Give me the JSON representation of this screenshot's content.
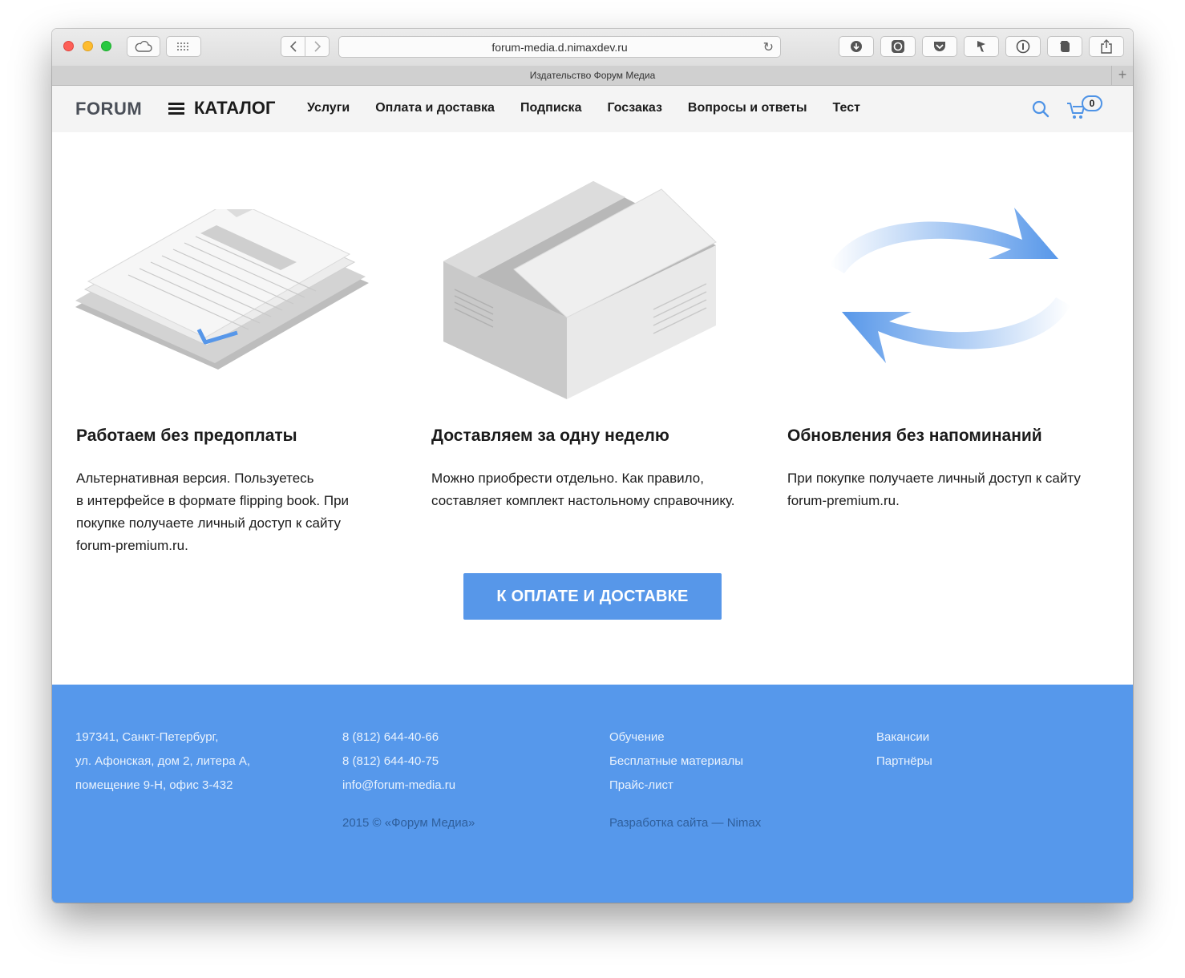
{
  "browser": {
    "url": "forum-media.d.nimaxdev.ru",
    "tab_title": "Издательство Форум Медиа",
    "icons": [
      "cloud-icon",
      "grid-icon",
      "back-icon",
      "forward-icon",
      "reload-icon",
      "download-icon",
      "camera-icon",
      "pocket-icon",
      "bird-icon",
      "info-icon",
      "evernote-icon",
      "share-icon"
    ]
  },
  "header": {
    "logo": "FORUM",
    "catalog": "КАТАЛОГ",
    "nav": [
      "Услуги",
      "Оплата и доставка",
      "Подписка",
      "Госзаказ",
      "Вопросы и ответы",
      "Тест"
    ],
    "cart_count": "0",
    "accent": "#4e93e6"
  },
  "features": [
    {
      "title": "Работаем без предоплаты",
      "text": [
        "Альтернативная версия. Пользуетесь",
        "в интерфейсе в формате flipping book. При",
        "покупке получаете личный доступ к сайту",
        "forum-premium.ru."
      ]
    },
    {
      "title": "Доставляем за одну неделю",
      "text": [
        "Можно приобрести отдельно. Как правило,",
        "составляет комплект настольному справочнику."
      ]
    },
    {
      "title": "Обновления без напоминаний",
      "text": [
        "При покупке получаете личный доступ к сайту",
        "forum-premium.ru."
      ]
    }
  ],
  "cta": "К ОПЛАТЕ И ДОСТАВКЕ",
  "footer": {
    "address": [
      "197341, Санкт-Петербург,",
      "ул. Афонская, дом 2, литера А,",
      "помещение 9-Н, офис 3-432"
    ],
    "contacts": [
      "8 (812) 644-40-66",
      "8 (812) 644-40-75",
      "info@forum-media.ru"
    ],
    "links1": [
      "Обучение",
      "Бесплатные материалы",
      "Прайс-лист"
    ],
    "links2": [
      "Вакансии",
      "Партнёры"
    ],
    "copyright": "2015 © «Форум Медиа»",
    "developer": "Разработка сайта — Nimax",
    "color": "#5698eb"
  }
}
